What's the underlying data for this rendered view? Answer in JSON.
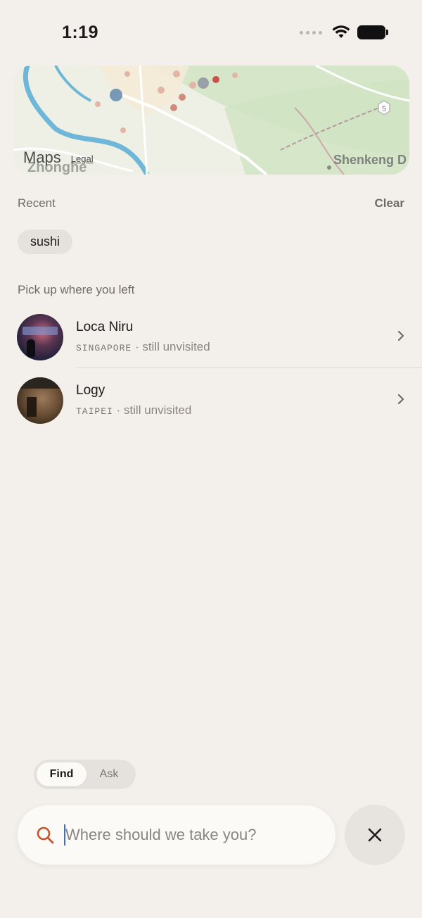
{
  "status_bar": {
    "time": "1:19"
  },
  "map": {
    "brand": "Maps",
    "legal": "Legal",
    "place_left": "Zhonghe",
    "place_right": "Shenkeng D",
    "route_badge": "5",
    "colors": {
      "water": "#6fb7d8",
      "land": "#eef0e6",
      "park": "#cfe3c2"
    }
  },
  "recent": {
    "label": "Recent",
    "clear_label": "Clear",
    "chips": [
      {
        "label": "sushi"
      }
    ]
  },
  "pickup": {
    "label": "Pick up where you left",
    "items": [
      {
        "name": "Loca Niru",
        "city": "SINGAPORE",
        "status": " · still unvisited"
      },
      {
        "name": "Logy",
        "city": "TAIPEI",
        "status": " · still unvisited"
      }
    ]
  },
  "mode_toggle": {
    "find_label": "Find",
    "ask_label": "Ask",
    "selected": "Find"
  },
  "search": {
    "placeholder": "Where should we take you?",
    "value": ""
  },
  "colors": {
    "background": "#f3f0ec",
    "accent": "#c4562b",
    "caret": "#2f6fe0"
  }
}
